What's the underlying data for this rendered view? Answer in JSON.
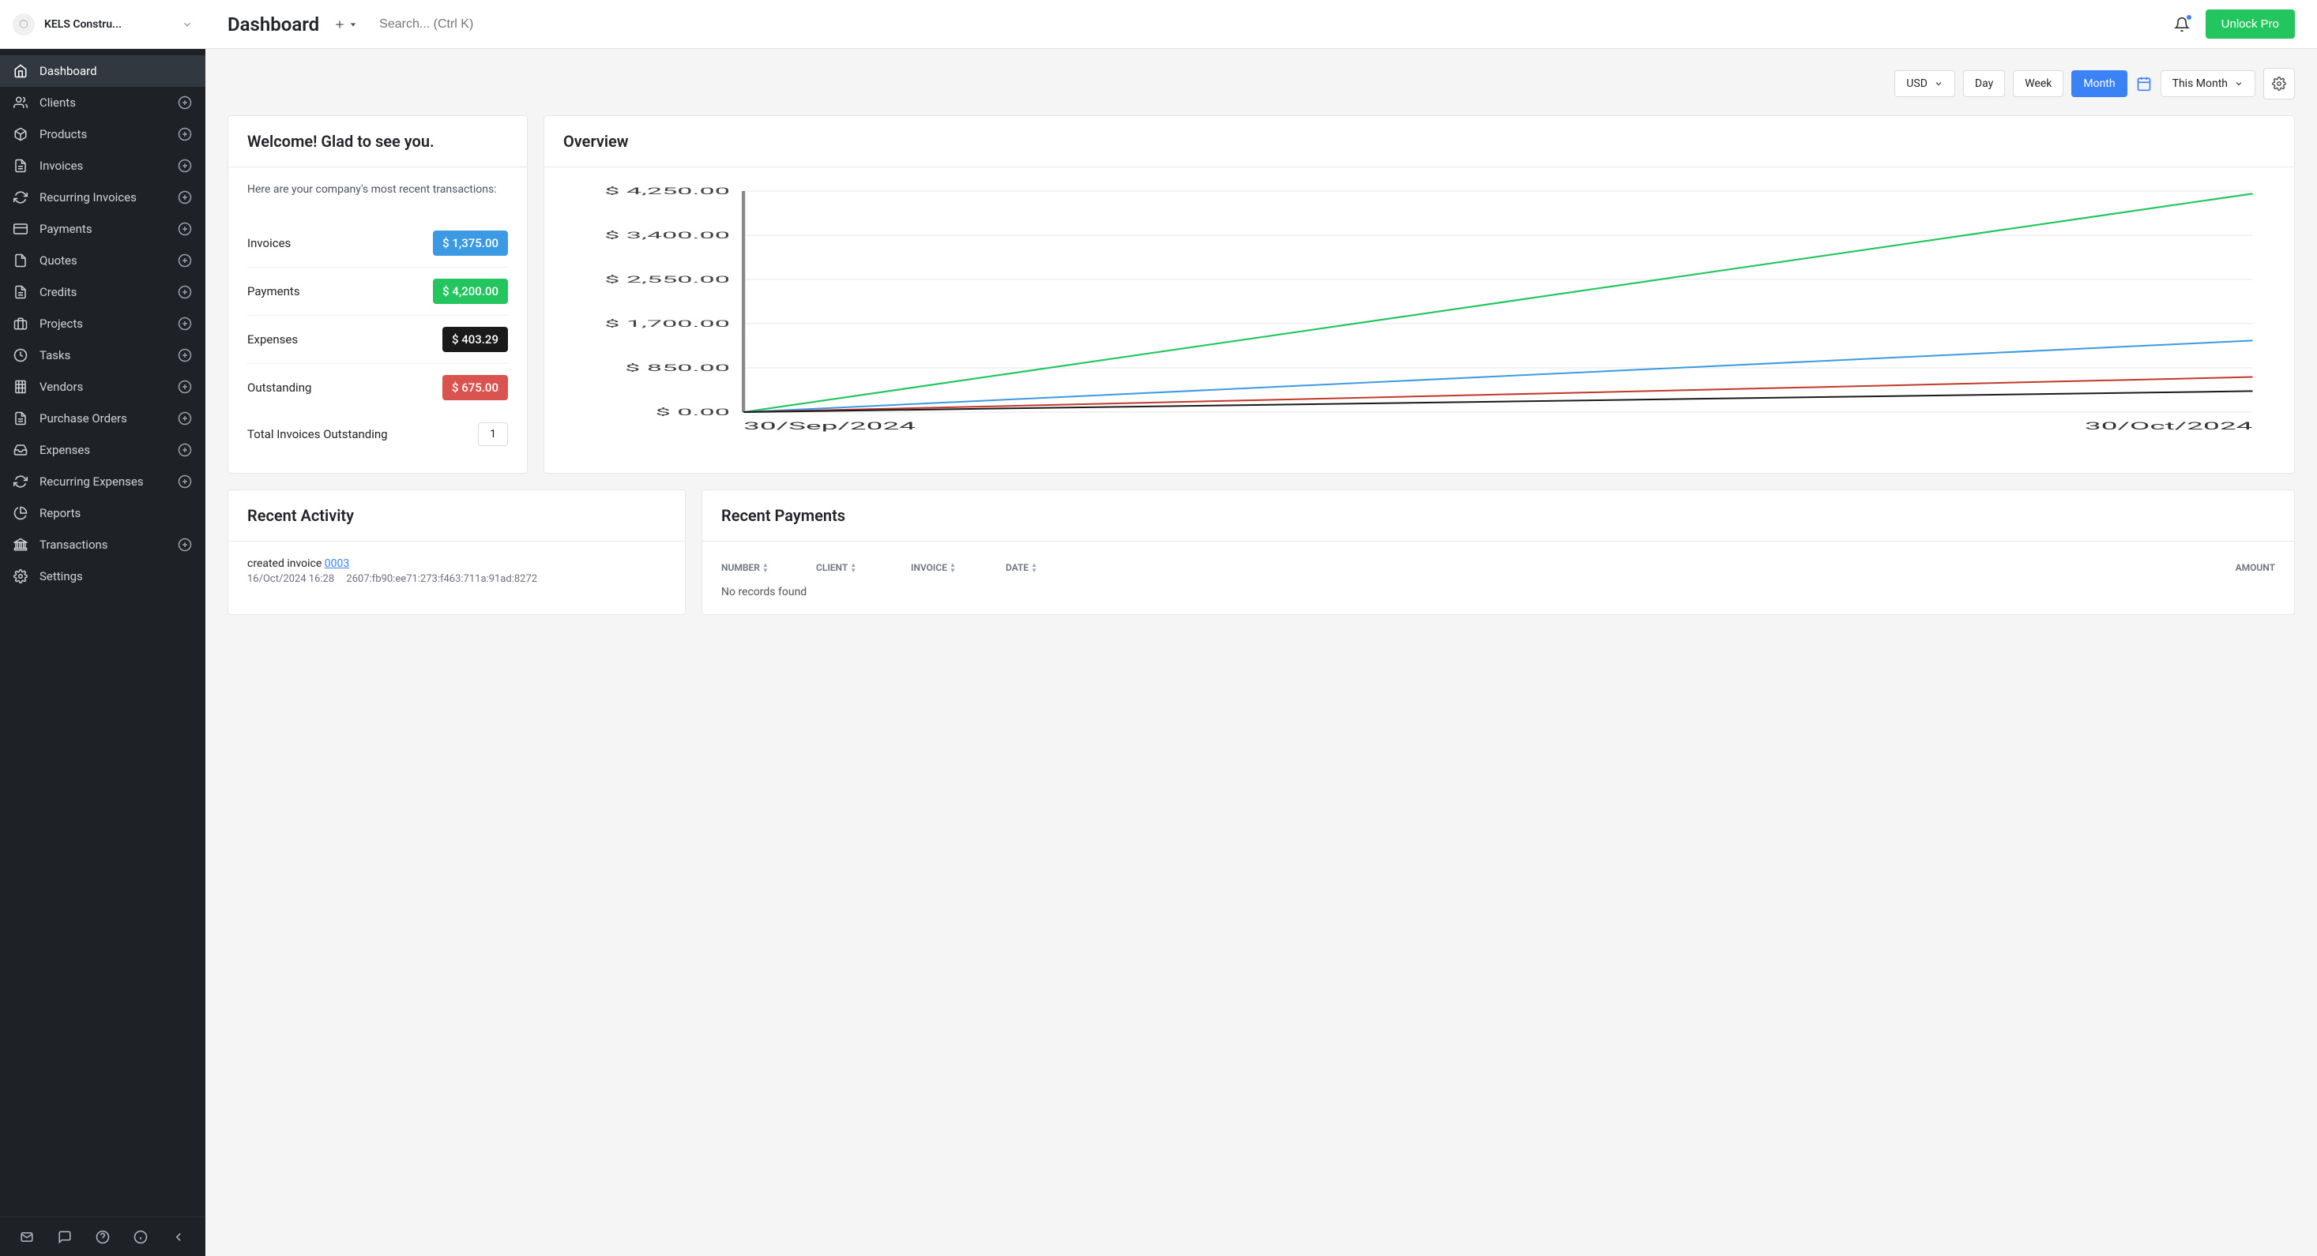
{
  "company": {
    "name": "KELS Constru..."
  },
  "header": {
    "title": "Dashboard",
    "search_placeholder": "Search... (Ctrl K)",
    "unlock_label": "Unlock Pro"
  },
  "sidebar": {
    "items": [
      {
        "label": "Dashboard",
        "icon": "home",
        "plus": false,
        "active": true
      },
      {
        "label": "Clients",
        "icon": "users",
        "plus": true
      },
      {
        "label": "Products",
        "icon": "box",
        "plus": true
      },
      {
        "label": "Invoices",
        "icon": "file-text",
        "plus": true
      },
      {
        "label": "Recurring Invoices",
        "icon": "refresh",
        "plus": true
      },
      {
        "label": "Payments",
        "icon": "credit-card",
        "plus": true
      },
      {
        "label": "Quotes",
        "icon": "file",
        "plus": true
      },
      {
        "label": "Credits",
        "icon": "file-text",
        "plus": true
      },
      {
        "label": "Projects",
        "icon": "briefcase",
        "plus": true
      },
      {
        "label": "Tasks",
        "icon": "clock",
        "plus": true
      },
      {
        "label": "Vendors",
        "icon": "building",
        "plus": true
      },
      {
        "label": "Purchase Orders",
        "icon": "file-text",
        "plus": true
      },
      {
        "label": "Expenses",
        "icon": "inbox",
        "plus": true
      },
      {
        "label": "Recurring Expenses",
        "icon": "refresh",
        "plus": true
      },
      {
        "label": "Reports",
        "icon": "pie",
        "plus": false
      },
      {
        "label": "Transactions",
        "icon": "bank",
        "plus": true
      },
      {
        "label": "Settings",
        "icon": "gear",
        "plus": false
      }
    ]
  },
  "filters": {
    "currency": "USD",
    "ranges": [
      "Day",
      "Week",
      "Month"
    ],
    "active_range": "Month",
    "period": "This Month"
  },
  "welcome": {
    "title": "Welcome! Glad to see you.",
    "subtext": "Here are your company's most recent transactions:",
    "stats": [
      {
        "label": "Invoices",
        "value": "$ 1,375.00",
        "color": "blue"
      },
      {
        "label": "Payments",
        "value": "$ 4,200.00",
        "color": "green"
      },
      {
        "label": "Expenses",
        "value": "$ 403.29",
        "color": "dark"
      },
      {
        "label": "Outstanding",
        "value": "$ 675.00",
        "color": "orange"
      }
    ],
    "total_outstanding_label": "Total Invoices Outstanding",
    "total_outstanding_count": "1"
  },
  "overview": {
    "title": "Overview"
  },
  "chart_data": {
    "type": "line",
    "x": [
      "30/Sep/2024",
      "30/Oct/2024"
    ],
    "ylim": [
      0,
      4250
    ],
    "yticks": [
      "$ 0.00",
      "$ 850.00",
      "$ 1,700.00",
      "$ 2,550.00",
      "$ 3,400.00",
      "$ 4,250.00"
    ],
    "series": [
      {
        "name": "Payments",
        "color": "#22c55e",
        "values": [
          0,
          4200
        ]
      },
      {
        "name": "Invoices",
        "color": "#3b9ae1",
        "values": [
          0,
          1375
        ]
      },
      {
        "name": "Outstanding",
        "color": "#c0392b",
        "values": [
          0,
          675
        ]
      },
      {
        "name": "Expenses",
        "color": "#1a1a1a",
        "values": [
          0,
          403.29
        ]
      }
    ]
  },
  "recent_activity": {
    "title": "Recent Activity",
    "entry_prefix": "created invoice ",
    "entry_link": "0003",
    "timestamp": "16/Oct/2024 16:28",
    "ip": "2607:fb90:ee71:273:f463:711a:91ad:8272"
  },
  "recent_payments": {
    "title": "Recent Payments",
    "columns": [
      "NUMBER",
      "CLIENT",
      "INVOICE",
      "DATE",
      "AMOUNT"
    ],
    "no_records": "No records found"
  }
}
